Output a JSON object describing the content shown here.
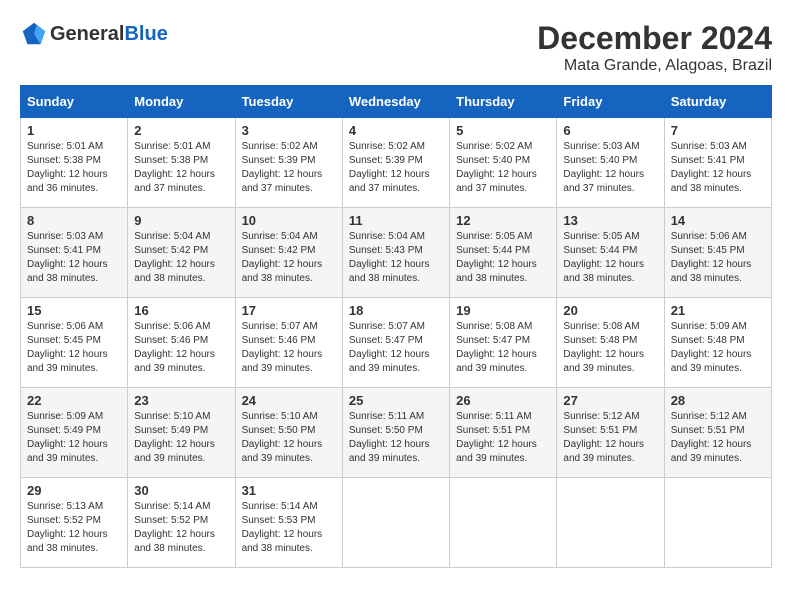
{
  "header": {
    "logo": {
      "general": "General",
      "blue": "Blue"
    },
    "title": "December 2024",
    "location": "Mata Grande, Alagoas, Brazil"
  },
  "calendar": {
    "weekdays": [
      "Sunday",
      "Monday",
      "Tuesday",
      "Wednesday",
      "Thursday",
      "Friday",
      "Saturday"
    ],
    "weeks": [
      [
        null,
        {
          "day": 2,
          "sunrise": "5:01 AM",
          "sunset": "5:38 PM",
          "daylight": "12 hours and 37 minutes."
        },
        {
          "day": 3,
          "sunrise": "5:02 AM",
          "sunset": "5:39 PM",
          "daylight": "12 hours and 37 minutes."
        },
        {
          "day": 4,
          "sunrise": "5:02 AM",
          "sunset": "5:39 PM",
          "daylight": "12 hours and 37 minutes."
        },
        {
          "day": 5,
          "sunrise": "5:02 AM",
          "sunset": "5:40 PM",
          "daylight": "12 hours and 37 minutes."
        },
        {
          "day": 6,
          "sunrise": "5:03 AM",
          "sunset": "5:40 PM",
          "daylight": "12 hours and 37 minutes."
        },
        {
          "day": 7,
          "sunrise": "5:03 AM",
          "sunset": "5:41 PM",
          "daylight": "12 hours and 38 minutes."
        }
      ],
      [
        {
          "day": 8,
          "sunrise": "5:03 AM",
          "sunset": "5:41 PM",
          "daylight": "12 hours and 38 minutes."
        },
        {
          "day": 9,
          "sunrise": "5:04 AM",
          "sunset": "5:42 PM",
          "daylight": "12 hours and 38 minutes."
        },
        {
          "day": 10,
          "sunrise": "5:04 AM",
          "sunset": "5:42 PM",
          "daylight": "12 hours and 38 minutes."
        },
        {
          "day": 11,
          "sunrise": "5:04 AM",
          "sunset": "5:43 PM",
          "daylight": "12 hours and 38 minutes."
        },
        {
          "day": 12,
          "sunrise": "5:05 AM",
          "sunset": "5:44 PM",
          "daylight": "12 hours and 38 minutes."
        },
        {
          "day": 13,
          "sunrise": "5:05 AM",
          "sunset": "5:44 PM",
          "daylight": "12 hours and 38 minutes."
        },
        {
          "day": 14,
          "sunrise": "5:06 AM",
          "sunset": "5:45 PM",
          "daylight": "12 hours and 38 minutes."
        }
      ],
      [
        {
          "day": 15,
          "sunrise": "5:06 AM",
          "sunset": "5:45 PM",
          "daylight": "12 hours and 39 minutes."
        },
        {
          "day": 16,
          "sunrise": "5:06 AM",
          "sunset": "5:46 PM",
          "daylight": "12 hours and 39 minutes."
        },
        {
          "day": 17,
          "sunrise": "5:07 AM",
          "sunset": "5:46 PM",
          "daylight": "12 hours and 39 minutes."
        },
        {
          "day": 18,
          "sunrise": "5:07 AM",
          "sunset": "5:47 PM",
          "daylight": "12 hours and 39 minutes."
        },
        {
          "day": 19,
          "sunrise": "5:08 AM",
          "sunset": "5:47 PM",
          "daylight": "12 hours and 39 minutes."
        },
        {
          "day": 20,
          "sunrise": "5:08 AM",
          "sunset": "5:48 PM",
          "daylight": "12 hours and 39 minutes."
        },
        {
          "day": 21,
          "sunrise": "5:09 AM",
          "sunset": "5:48 PM",
          "daylight": "12 hours and 39 minutes."
        }
      ],
      [
        {
          "day": 22,
          "sunrise": "5:09 AM",
          "sunset": "5:49 PM",
          "daylight": "12 hours and 39 minutes."
        },
        {
          "day": 23,
          "sunrise": "5:10 AM",
          "sunset": "5:49 PM",
          "daylight": "12 hours and 39 minutes."
        },
        {
          "day": 24,
          "sunrise": "5:10 AM",
          "sunset": "5:50 PM",
          "daylight": "12 hours and 39 minutes."
        },
        {
          "day": 25,
          "sunrise": "5:11 AM",
          "sunset": "5:50 PM",
          "daylight": "12 hours and 39 minutes."
        },
        {
          "day": 26,
          "sunrise": "5:11 AM",
          "sunset": "5:51 PM",
          "daylight": "12 hours and 39 minutes."
        },
        {
          "day": 27,
          "sunrise": "5:12 AM",
          "sunset": "5:51 PM",
          "daylight": "12 hours and 39 minutes."
        },
        {
          "day": 28,
          "sunrise": "5:12 AM",
          "sunset": "5:51 PM",
          "daylight": "12 hours and 39 minutes."
        }
      ],
      [
        {
          "day": 29,
          "sunrise": "5:13 AM",
          "sunset": "5:52 PM",
          "daylight": "12 hours and 38 minutes."
        },
        {
          "day": 30,
          "sunrise": "5:14 AM",
          "sunset": "5:52 PM",
          "daylight": "12 hours and 38 minutes."
        },
        {
          "day": 31,
          "sunrise": "5:14 AM",
          "sunset": "5:53 PM",
          "daylight": "12 hours and 38 minutes."
        },
        null,
        null,
        null,
        null
      ]
    ],
    "week0_day1": {
      "day": 1,
      "sunrise": "5:01 AM",
      "sunset": "5:38 PM",
      "daylight": "12 hours and 36 minutes."
    }
  }
}
